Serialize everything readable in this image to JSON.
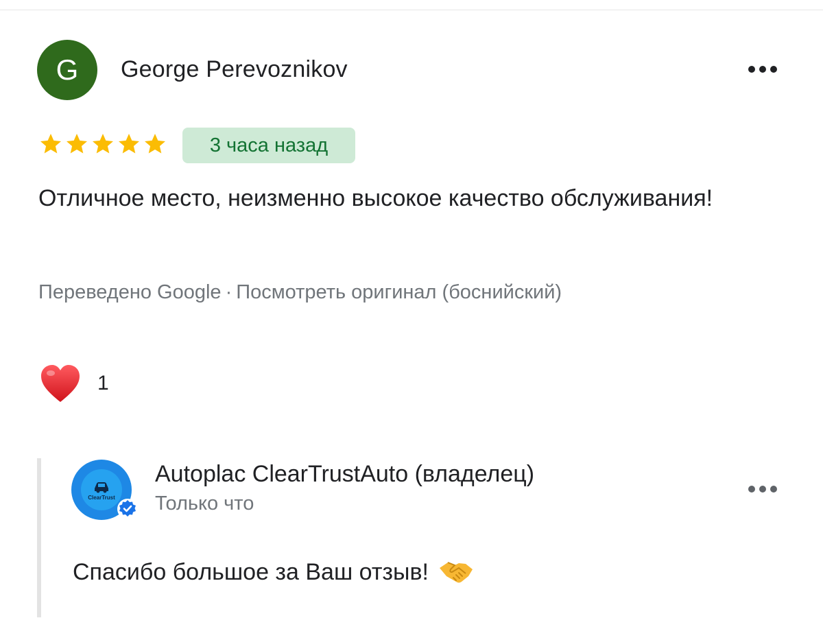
{
  "review": {
    "avatar_letter": "G",
    "author": "George Perevoznikov",
    "rating": 5,
    "time": "3 часа назад",
    "text": "Отличное место, неизменно высокое качество обслуживания!",
    "translated_by": "Переведено Google",
    "separator": "·",
    "view_original": "Посмотреть оригинал (боснийский)",
    "reaction_count": "1"
  },
  "reply": {
    "logo_text": "ClearTrust",
    "owner_name": "Autoplac ClearTrustAuto (владелец)",
    "time": "Только что",
    "text": "Спасибо большое за Ваш отзыв!"
  },
  "colors": {
    "avatar_bg": "#2f6a1c",
    "star": "#fbbc04",
    "badge_bg": "#ceead6",
    "badge_text": "#137333",
    "heart": "#e3262e",
    "verified": "#1a73e8"
  },
  "icons": [
    "more-options-icon",
    "star-icon",
    "heart-icon",
    "verified-badge-icon",
    "handshake-icon"
  ]
}
